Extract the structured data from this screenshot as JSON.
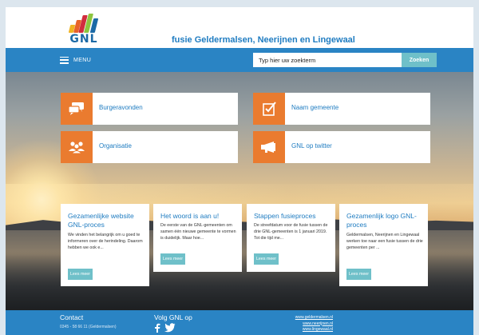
{
  "header": {
    "logo_text": "GNL",
    "title": "fusie Geldermalsen, Neerijnen en Lingewaal",
    "logo_colors": [
      "#f0b323",
      "#e8622a",
      "#d12d3e",
      "#8dc63f",
      "#1c6aa6",
      "#f0b323"
    ]
  },
  "navbar": {
    "menu_label": "MENU",
    "search_placeholder": "Typ hier uw zoekterm",
    "search_button": "Zoeken"
  },
  "tiles": [
    {
      "label": "Burgeravonden",
      "icon": "chat-bubbles-icon"
    },
    {
      "label": "Naam gemeente",
      "icon": "checklist-icon"
    },
    {
      "label": "Organisatie",
      "icon": "people-group-icon"
    },
    {
      "label": "GNL op twitter",
      "icon": "megaphone-icon"
    }
  ],
  "cards": [
    {
      "title": "Gezamenlijke website GNL-proces",
      "text": "We vinden het belangrijk om u goed te informeren over de herindeling. Daarom hebben we ook e...",
      "button": "Lees meer"
    },
    {
      "title": "Het woord is aan u!",
      "text": "De eerste van de GNL-gemeenten om samen één nieuwe gemeente te vormen is duidelijk. Maar hoe...",
      "button": "Lees meer"
    },
    {
      "title": "Stappen fusieproces",
      "text": "De streefdatum voor de fusie tussen de drie GNL-gemeenten is 1 januari 2019. Tot die tijd me...",
      "button": "Lees meer"
    },
    {
      "title": "Gezamenlijk logo GNL-proces",
      "text": "Geldermalsen, Neerijnen en Lingewaal werken toe naar een fusie tussen de drie gemeenten per ...",
      "button": "Lees meer"
    }
  ],
  "footer": {
    "contact_title": "Contact",
    "phone": "0345 - 58 66 11 (Geldermalsen)",
    "follow_title": "Volg GNL op",
    "links": [
      "www.geldermalsen.nl",
      "www.neerijnen.nl",
      "www.lingewaal.nl"
    ]
  },
  "colors": {
    "accent_blue": "#2a84c4",
    "link_blue": "#1f7cc1",
    "tile_orange": "#ea7b2f",
    "button_teal": "#6fc0c9"
  }
}
